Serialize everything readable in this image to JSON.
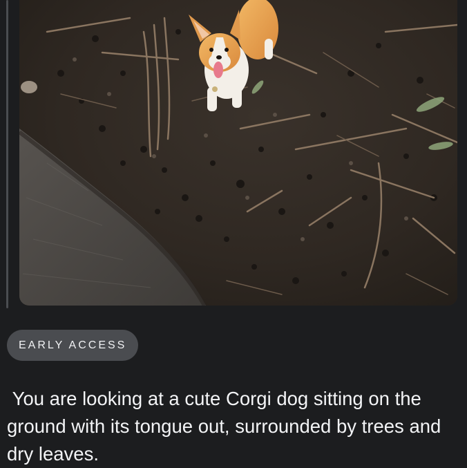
{
  "message": {
    "photo": {
      "subject": "corgi-dog-on-forest-floor",
      "colors": {
        "ground": "#2f2822",
        "path": "#4d4a47",
        "dog_fur": "#e9a351",
        "dog_white": "#f3efe8",
        "tongue": "#e77a8c"
      }
    },
    "badge": {
      "label": "EARLY ACCESS"
    },
    "response_text": " You are looking at a cute Corgi dog sitting on the ground with its tongue out, surrounded by trees and dry leaves."
  },
  "theme": {
    "background": "#1c1d1f",
    "badge_bg": "#4a4c50",
    "text": "#f3f4f6"
  }
}
